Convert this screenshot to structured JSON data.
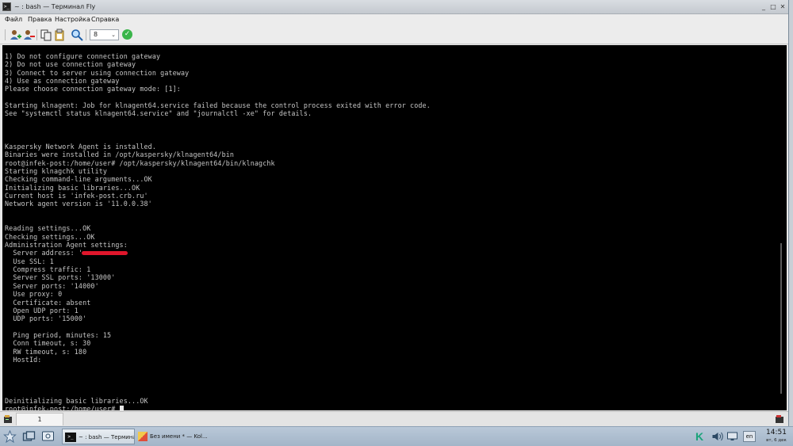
{
  "window": {
    "title": "~ : bash — Терминал Fly",
    "app_icon_glyph": ">_",
    "controls": [
      "_",
      "□",
      "✕"
    ]
  },
  "menu": {
    "items": [
      "Файл",
      "Правка",
      "Настройка",
      "Справка"
    ]
  },
  "toolbar": {
    "buttons": [
      "new-session-icon",
      "close-session-icon",
      "copy-icon",
      "paste-icon",
      "find-icon"
    ],
    "font_size_value": "8",
    "apply_icon": "checkmark-icon"
  },
  "terminal": {
    "lines": [
      "1) Do not configure connection gateway",
      "2) Do not use connection gateway",
      "3) Connect to server using connection gateway",
      "4) Use as connection gateway",
      "Please choose connection gateway mode: [1]:",
      "",
      "Starting klnagent: Job for klnagent64.service failed because the control process exited with error code.",
      "See \"systemctl status klnagent64.service\" and \"journalctl -xe\" for details.",
      "",
      "",
      "",
      "Kaspersky Network Agent is installed.",
      "Binaries were installed in /opt/kaspersky/klnagent64/bin",
      "root@infek-post:/home/user# /opt/kaspersky/klnagent64/bin/klnagchk",
      "Starting klnagchk utility",
      "Checking command-line arguments...OK",
      "Initializing basic libraries...OK",
      "Current host is 'infek-post.crb.ru'",
      "Network agent version is '11.0.0.38'",
      "",
      "",
      "Reading settings...OK",
      "Checking settings...OK",
      "Administration Agent settings:",
      "  Server address: '",
      "  Use SSL: 1",
      "  Compress traffic: 1",
      "  Server SSL ports: '13000'",
      "  Server ports: '14000'",
      "  Use proxy: 0",
      "  Certificate: absent",
      "  Open UDP port: 1",
      "  UDP ports: '15000'",
      "",
      "  Ping period, minutes: 15",
      "  Conn timeout, s: 30",
      "  RW timeout, s: 180",
      "  HostId:",
      "",
      "",
      "",
      "",
      "Deinitializing basic libraries...OK",
      "root@infek-post:/home/user# "
    ]
  },
  "tabs": {
    "items": [
      "1"
    ]
  },
  "taskbar": {
    "tasks": [
      {
        "label": "~ : bash — Термина..."
      },
      {
        "label": "Без имени * — Kol..."
      }
    ],
    "language": "en",
    "time": "14:51",
    "date": "вт, 6 дек"
  },
  "colors": {
    "terminal_bg": "#000000",
    "terminal_fg": "#c6c6c6",
    "accent": "#3ab54a",
    "redaction": "#e0162b"
  }
}
